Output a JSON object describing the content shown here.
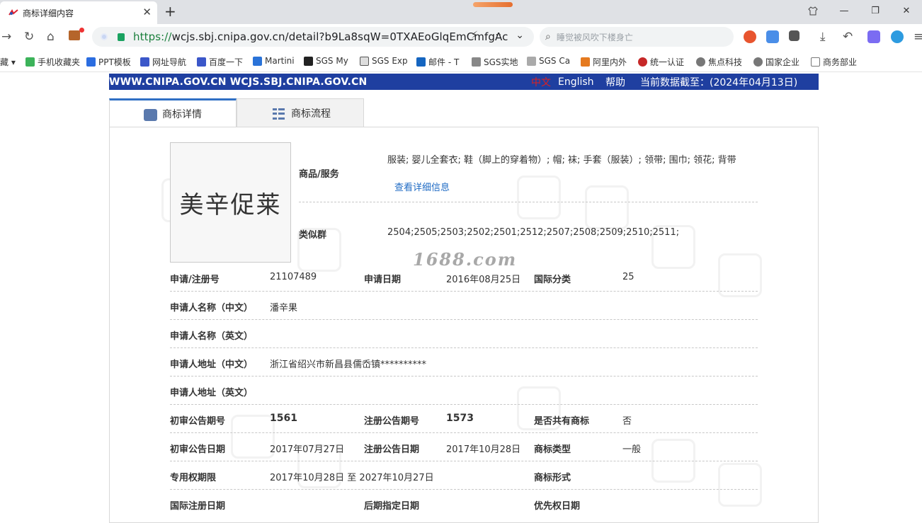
{
  "browser": {
    "tab_title": "商标详细内容",
    "tab_close": "✕",
    "new_tab": "+",
    "url_prefix": "https://",
    "url_rest": "wcjs.sbj.cnipa.gov.cn/detail?b9La8sqW=0TXAEoGlqEmCmfgAc",
    "search_placeholder": "睡觉被风吹下楼身亡"
  },
  "bookmarks": [
    "手机收藏夹",
    "PPT模板",
    "网址导航",
    "百度一下",
    "Martini",
    "SGS My",
    "SGS Exp",
    "邮件 - T",
    "SGS实地",
    "SGS Ca",
    "阿里内外",
    "统一认证",
    "焦点科技",
    "国家企业",
    "商务部业"
  ],
  "bookmarks_prefix": "藏",
  "banner": {
    "site": "WWW.CNIPA.GOV.CN WCJS.SBJ.CNIPA.GOV.CN",
    "lang_cn": "中文",
    "lang_en": "English",
    "help": "帮助",
    "date": "当前数据截至：(2024年04月13日)"
  },
  "tabs": {
    "detail": "商标详情",
    "flow": "商标流程"
  },
  "mark_text": "美辛促莱",
  "watermark": "1688.com",
  "goods": {
    "label": "商品/服务",
    "value": "服装; 婴儿全套衣; 鞋（脚上的穿着物）; 帽; 袜; 手套（服装）; 领带; 围巾; 领花; 背带",
    "link": "查看详细信息"
  },
  "similar": {
    "label": "类似群",
    "value": "2504;2505;2503;2502;2501;2512;2507;2508;2509;2510;2511;"
  },
  "fields": {
    "reg_no_label": "申请/注册号",
    "reg_no": "21107489",
    "apply_date_label": "申请日期",
    "apply_date": "2016年08月25日",
    "intl_class_label": "国际分类",
    "intl_class": "25",
    "applicant_cn_label": "申请人名称（中文）",
    "applicant_cn": "潘辛果",
    "applicant_en_label": "申请人名称（英文）",
    "address_cn_label": "申请人地址（中文）",
    "address_cn": "浙江省绍兴市新昌县儒岙镇**********",
    "address_en_label": "申请人地址（英文）",
    "prelim_no_label": "初审公告期号",
    "prelim_no": "1561",
    "reg_pub_no_label": "注册公告期号",
    "reg_pub_no": "1573",
    "shared_label": "是否共有商标",
    "shared": "否",
    "prelim_date_label": "初审公告日期",
    "prelim_date": "2017年07月27日",
    "reg_pub_date_label": "注册公告日期",
    "reg_pub_date": "2017年10月28日",
    "mark_type_label": "商标类型",
    "mark_type": "一般",
    "term_label": "专用权期限",
    "term": "2017年10月28日 至 2027年10月27日",
    "mark_form_label": "商标形式",
    "intl_reg_date_label": "国际注册日期",
    "later_date_label": "后期指定日期",
    "priority_date_label": "优先权日期"
  },
  "colors": {
    "banner": "#1f3fa0",
    "link": "#1f6bc4",
    "tab_accent": "#2f6fc4",
    "url_green": "#1a7f3c"
  }
}
